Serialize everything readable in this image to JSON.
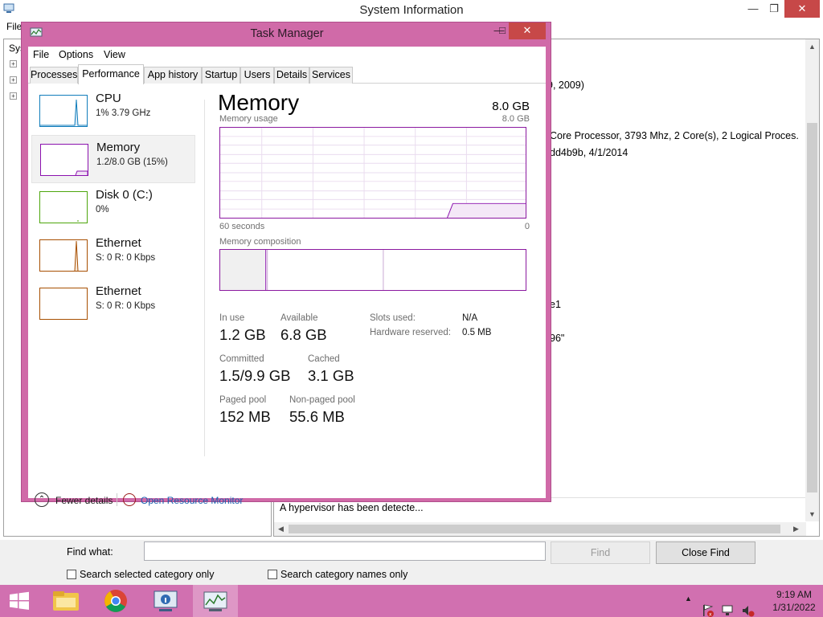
{
  "system_info": {
    "title": "System Information",
    "menu_file": "File",
    "tree_root_label": "Sys",
    "detail_lines": [
      {
        "text": "9, 2009)"
      },
      {
        "text": "Core Processor, 3793 Mhz, 2 Core(s), 2 Logical Proces."
      },
      {
        "text": "dd4b9b, 4/1/2014"
      },
      {
        "text": "e1"
      },
      {
        "text": "96\""
      }
    ],
    "hypervisor_text": "A hypervisor has been detecte...",
    "find_label": "Find what:",
    "find_value": "",
    "find_button": "Find",
    "close_find_button": "Close Find",
    "check_selected_category": "Search selected category only",
    "check_category_names": "Search category names only"
  },
  "task_manager": {
    "title": "Task Manager",
    "menu": [
      "File",
      "Options",
      "View"
    ],
    "tabs": [
      "Processes",
      "Performance",
      "App history",
      "Startup",
      "Users",
      "Details",
      "Services"
    ],
    "active_tab": "Performance",
    "resources": [
      {
        "name": "CPU",
        "sub": "1% 3.79 GHz",
        "color": "#117dbb"
      },
      {
        "name": "Memory",
        "sub": "1.2/8.0 GB (15%)",
        "color": "#8b12ae"
      },
      {
        "name": "Disk 0 (C:)",
        "sub": "0%",
        "color": "#4da60c"
      },
      {
        "name": "Ethernet",
        "sub": "S: 0 R: 0 Kbps",
        "color": "#a74f01"
      },
      {
        "name": "Ethernet",
        "sub": "S: 0 R: 0 Kbps",
        "color": "#a74f01"
      }
    ],
    "memory": {
      "title": "Memory",
      "total": "8.0 GB",
      "usage_label": "Memory usage",
      "usage_max": "8.0 GB",
      "time_left": "60 seconds",
      "time_right": "0",
      "composition_label": "Memory composition",
      "in_use_label": "In use",
      "in_use": "1.2 GB",
      "available_label": "Available",
      "available": "6.8 GB",
      "committed_label": "Committed",
      "committed": "1.5/9.9 GB",
      "cached_label": "Cached",
      "cached": "3.1 GB",
      "paged_label": "Paged pool",
      "paged": "152 MB",
      "nonpaged_label": "Non-paged pool",
      "nonpaged": "55.6 MB",
      "slots_label": "Slots used:",
      "slots": "N/A",
      "hw_reserved_label": "Hardware reserved:",
      "hw_reserved": "0.5 MB"
    },
    "fewer_details": "Fewer details",
    "open_resource_monitor": "Open Resource Monitor"
  },
  "taskbar": {
    "time": "9:19 AM",
    "date": "1/31/2022"
  }
}
